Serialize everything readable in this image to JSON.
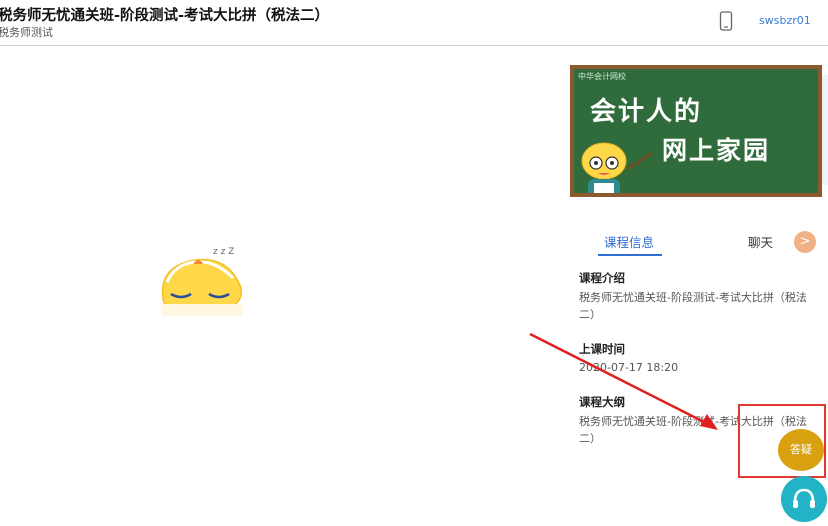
{
  "header": {
    "title": "税务师无忧通关班-阶段测试-考试大比拼（税法二）",
    "subtitle": "税务师测试",
    "username": "swsbzr01"
  },
  "sidebar": {
    "banner": {
      "brand": "中华会计网校",
      "line1": "会计人的",
      "line2": "网上家园"
    },
    "tabs": [
      {
        "label": "课程信息",
        "active": true
      },
      {
        "label": "聊天",
        "active": false
      }
    ],
    "expand_label": ">",
    "sections": [
      {
        "title": "课程介绍",
        "text": "税务师无忧通关班-阶段测试-考试大比拼（税法二）"
      },
      {
        "title": "上课时间",
        "text": "2020-07-17 18:20"
      },
      {
        "title": "课程大纲",
        "text": "税务师无忧通关班-阶段测试-考试大比拼（税法二）"
      }
    ]
  },
  "buttons": {
    "qa_label": "答疑"
  },
  "colors": {
    "accent": "#2f6fd0",
    "highlight_box": "#e03a2d",
    "qa_button": "#d9a10f",
    "service_button": "#22b3c6",
    "chalkboard": "#2f6b3b"
  },
  "icons": {
    "header_device": "phone-icon",
    "service": "headset-icon",
    "video_placeholder": "sleeping-mascot-icon",
    "annotation": "red-arrow-icon"
  }
}
